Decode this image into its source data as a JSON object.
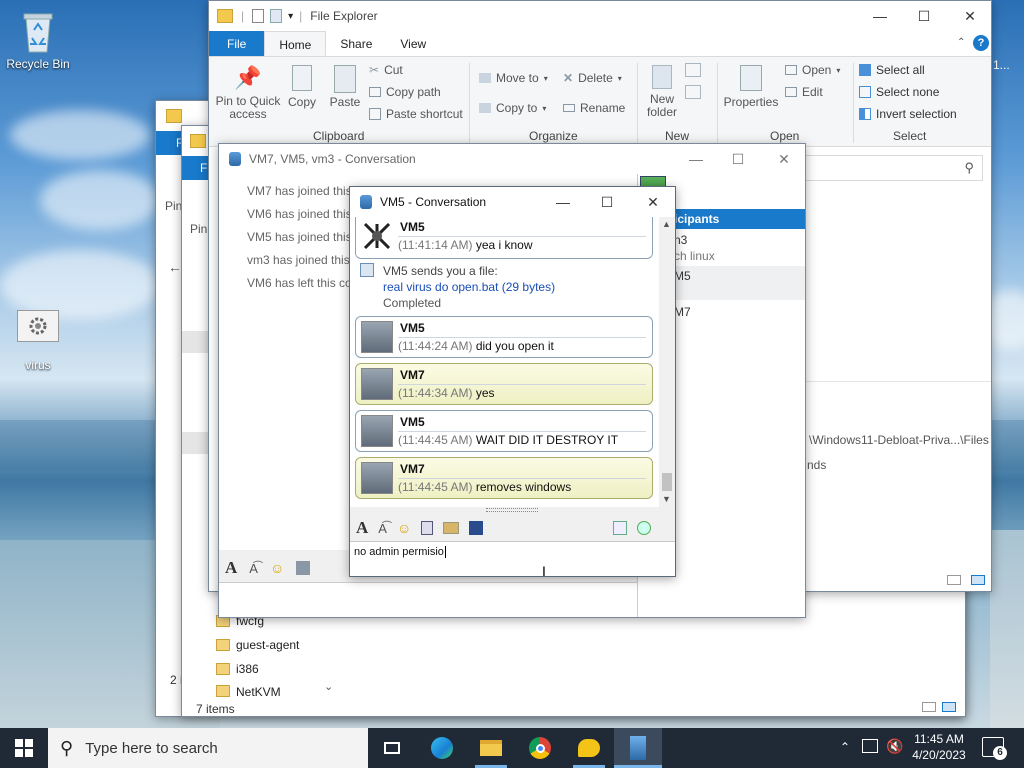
{
  "desktop": {
    "recycle_bin_label": "Recycle Bin",
    "virus_label": "virus",
    "right_edge_text": "1..."
  },
  "explorer_main": {
    "title": "File Explorer",
    "tabs": [
      "File",
      "Home",
      "Share",
      "View"
    ],
    "clipboard": {
      "pin_label": "Pin to Quick access",
      "copy_label": "Copy",
      "paste_label": "Paste",
      "cut_label": "Cut",
      "copy_path_label": "Copy path",
      "paste_shortcut_label": "Paste shortcut",
      "group_label": "Clipboard"
    },
    "organize": {
      "move_to_label": "Move to",
      "copy_to_label": "Copy to",
      "delete_label": "Delete",
      "rename_label": "Rename",
      "group_label": "Organize"
    },
    "new": {
      "new_folder_label": "New folder",
      "group_label": "New"
    },
    "open": {
      "properties_label": "Properties",
      "open_label": "Open",
      "edit_label": "Edit",
      "group_label": "Open"
    },
    "select": {
      "select_all_label": "Select all",
      "select_none_label": "Select none",
      "invert_label": "Invert selection",
      "group_label": "Select"
    },
    "path_text": "\\Windows11-Debloat-Priva...\\Files",
    "path_text_2": "nds"
  },
  "explorer_back": {
    "pin_text": "Pin",
    "items": [
      "fwcfg",
      "guest-agent",
      "i386",
      "NetKVM"
    ],
    "status": "7 items",
    "status_other": "2 i"
  },
  "group_conv": {
    "title": "VM7, VM5, vm3 - Conversation",
    "log": [
      "VM7 has joined this",
      "VM6 has joined this",
      "VM5 has joined this",
      "vm3 has joined this",
      "VM6 has left this co"
    ],
    "participants_header": "icipants",
    "participants": [
      "n3",
      "ch linux",
      "M5",
      "M7"
    ]
  },
  "vm5_conv": {
    "title": "VM5 - Conversation",
    "messages": [
      {
        "sender": "VM5",
        "time": "(11:41:14 AM)",
        "text": "yea i know"
      },
      {
        "sender": "VM5",
        "time": "(11:44:24 AM)",
        "text": "did you open it"
      },
      {
        "sender": "VM7",
        "time": "(11:44:34 AM)",
        "text": "yes"
      },
      {
        "sender": "VM5",
        "time": "(11:44:45 AM)",
        "text": "WAIT DID IT DESTROY IT"
      },
      {
        "sender": "VM7",
        "time": "(11:44:45 AM)",
        "text": "removes windows"
      }
    ],
    "file_transfer": {
      "header": "VM5 sends you a file:",
      "file_link": "real virus do open.bat (29 bytes)",
      "status": "Completed"
    },
    "input_value": "no admin permisio"
  },
  "taskbar": {
    "search_placeholder": "Type here to search",
    "time": "11:45 AM",
    "date": "4/20/2023",
    "notification_count": "6"
  },
  "colors": {
    "accent": "#1979ca",
    "taskbar": "#1f2a36",
    "link": "#1a4fb8",
    "selected_header": "#1979ca"
  }
}
